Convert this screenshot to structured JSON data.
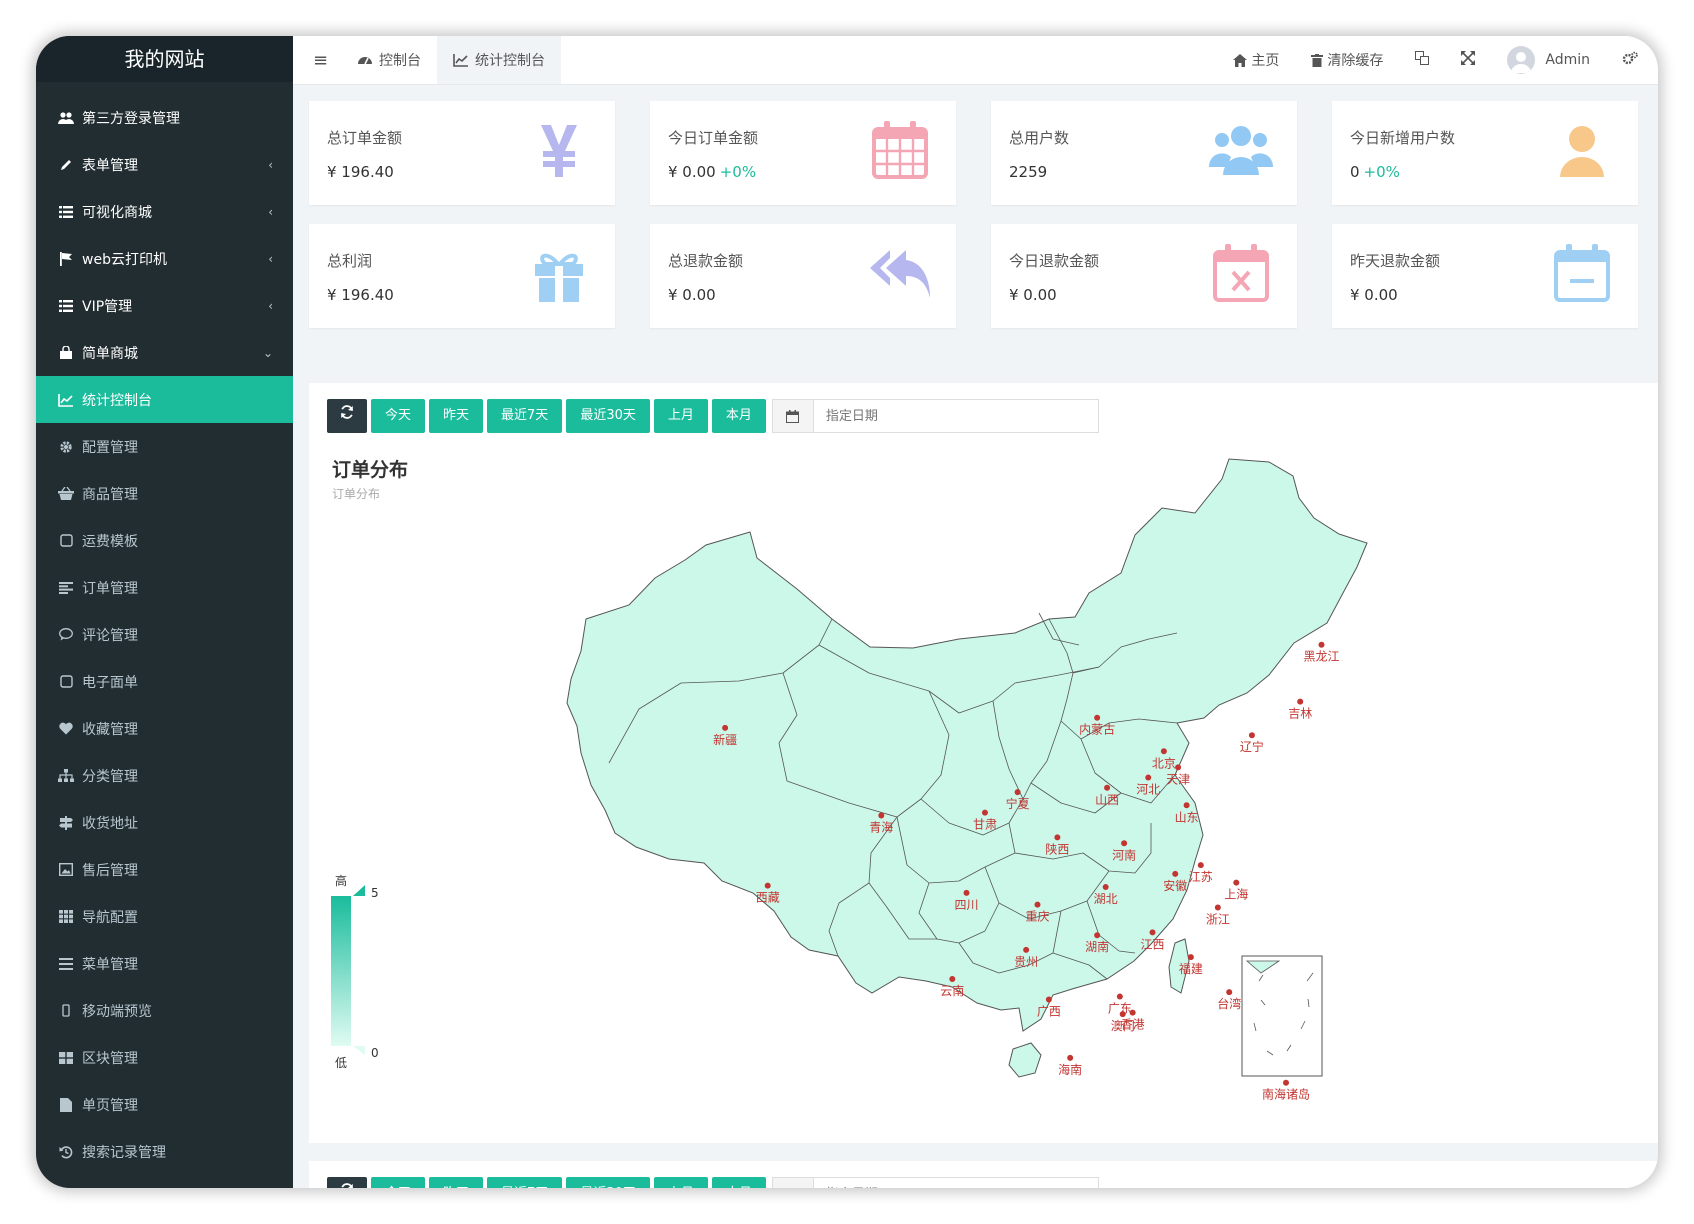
{
  "sidebar": {
    "logo": "我的网站",
    "items": [
      {
        "label": "第三方登录管理",
        "icon": "users-icon",
        "arrow": ""
      },
      {
        "label": "表单管理",
        "icon": "pencil-icon",
        "arrow": "‹"
      },
      {
        "label": "可视化商城",
        "icon": "list-icon",
        "arrow": "‹"
      },
      {
        "label": "web云打印机",
        "icon": "flag-icon",
        "arrow": "‹"
      },
      {
        "label": "VIP管理",
        "icon": "list-icon",
        "arrow": "‹"
      },
      {
        "label": "简单商城",
        "icon": "shopping-bag-icon",
        "arrow": "⌄"
      },
      {
        "label": "统计控制台",
        "icon": "line-chart-icon",
        "arrow": ""
      },
      {
        "label": "配置管理",
        "icon": "gear-icon",
        "arrow": ""
      },
      {
        "label": "商品管理",
        "icon": "basket-icon",
        "arrow": ""
      },
      {
        "label": "运费模板",
        "icon": "square-icon",
        "arrow": ""
      },
      {
        "label": "订单管理",
        "icon": "align-left-icon",
        "arrow": ""
      },
      {
        "label": "评论管理",
        "icon": "comment-icon",
        "arrow": ""
      },
      {
        "label": "电子面单",
        "icon": "square-icon",
        "arrow": ""
      },
      {
        "label": "收藏管理",
        "icon": "heart-icon",
        "arrow": ""
      },
      {
        "label": "分类管理",
        "icon": "sitemap-icon",
        "arrow": ""
      },
      {
        "label": "收货地址",
        "icon": "signpost-icon",
        "arrow": ""
      },
      {
        "label": "售后管理",
        "icon": "image-icon",
        "arrow": ""
      },
      {
        "label": "导航配置",
        "icon": "grid-icon",
        "arrow": ""
      },
      {
        "label": "菜单管理",
        "icon": "bars-icon",
        "arrow": ""
      },
      {
        "label": "移动端预览",
        "icon": "mobile-icon",
        "arrow": ""
      },
      {
        "label": "区块管理",
        "icon": "th-large-icon",
        "arrow": ""
      },
      {
        "label": "单页管理",
        "icon": "file-icon",
        "arrow": ""
      },
      {
        "label": "搜索记录管理",
        "icon": "history-icon",
        "arrow": ""
      }
    ],
    "active_index": 6
  },
  "topnav": {
    "tabs": [
      {
        "label": "控制台",
        "icon": "dashboard-icon"
      },
      {
        "label": "统计控制台",
        "icon": "line-chart-icon"
      }
    ],
    "home": "主页",
    "clear_cache": "清除缓存",
    "user": "Admin"
  },
  "cards": [
    {
      "label": "总订单金额",
      "value": "¥ 196.40",
      "pct": "",
      "icon": "yen-icon",
      "color": "#b7b7f0"
    },
    {
      "label": "今日订单金额",
      "value": "¥ 0.00",
      "pct": "+0%",
      "icon": "calendar-icon",
      "color": "#f5a6b4"
    },
    {
      "label": "总用户数",
      "value": "2259",
      "pct": "",
      "icon": "users-icon",
      "color": "#92c8f4"
    },
    {
      "label": "今日新增用户数",
      "value": "0",
      "pct": "+0%",
      "icon": "user-icon",
      "color": "#f7c88a"
    },
    {
      "label": "总利润",
      "value": "¥ 196.40",
      "pct": "",
      "icon": "gift-icon",
      "color": "#9fd0f4"
    },
    {
      "label": "总退款金额",
      "value": "¥ 0.00",
      "pct": "",
      "icon": "reply-all-icon",
      "color": "#b7b7f0"
    },
    {
      "label": "今日退款金额",
      "value": "¥ 0.00",
      "pct": "",
      "icon": "calendar-times-icon",
      "color": "#f5a6b4"
    },
    {
      "label": "昨天退款金额",
      "value": "¥ 0.00",
      "pct": "",
      "icon": "calendar-minus-icon",
      "color": "#9fd0f4"
    }
  ],
  "filters": {
    "buttons": [
      "今天",
      "昨天",
      "最近7天",
      "最近30天",
      "上月",
      "本月"
    ],
    "date_placeholder": "指定日期"
  },
  "map": {
    "title": "订单分布",
    "subtitle": "订单分布",
    "visual_map": {
      "high_label": "高",
      "low_label": "低",
      "max": "5",
      "min": "0"
    },
    "fill_color": "#ccf8ea",
    "border_color": "#555555",
    "point_color": "#c23531",
    "provinces": [
      {
        "name": "黑龙江",
        "lon": 127.5,
        "lat": 47.5
      },
      {
        "name": "吉林",
        "lon": 126.0,
        "lat": 43.6
      },
      {
        "name": "辽宁",
        "lon": 122.6,
        "lat": 41.3
      },
      {
        "name": "内蒙古",
        "lon": 111.7,
        "lat": 42.5
      },
      {
        "name": "北京",
        "lon": 116.4,
        "lat": 40.2
      },
      {
        "name": "天津",
        "lon": 117.4,
        "lat": 39.1
      },
      {
        "name": "河北",
        "lon": 115.3,
        "lat": 38.4
      },
      {
        "name": "山西",
        "lon": 112.4,
        "lat": 37.7
      },
      {
        "name": "山东",
        "lon": 118.0,
        "lat": 36.5
      },
      {
        "name": "宁夏",
        "lon": 106.1,
        "lat": 37.4
      },
      {
        "name": "青海",
        "lon": 96.5,
        "lat": 35.8
      },
      {
        "name": "甘肃",
        "lon": 103.8,
        "lat": 36.0
      },
      {
        "name": "陕西",
        "lon": 108.9,
        "lat": 34.3
      },
      {
        "name": "河南",
        "lon": 113.6,
        "lat": 33.9
      },
      {
        "name": "新疆",
        "lon": 85.5,
        "lat": 41.8
      },
      {
        "name": "西藏",
        "lon": 88.5,
        "lat": 31.0
      },
      {
        "name": "四川",
        "lon": 102.5,
        "lat": 30.5
      },
      {
        "name": "重庆",
        "lon": 107.5,
        "lat": 29.7
      },
      {
        "name": "湖北",
        "lon": 112.3,
        "lat": 30.9
      },
      {
        "name": "安徽",
        "lon": 117.2,
        "lat": 31.8
      },
      {
        "name": "江苏",
        "lon": 119.0,
        "lat": 32.4
      },
      {
        "name": "上海",
        "lon": 121.5,
        "lat": 31.2
      },
      {
        "name": "浙江",
        "lon": 120.2,
        "lat": 29.5
      },
      {
        "name": "湖南",
        "lon": 111.7,
        "lat": 27.6
      },
      {
        "name": "江西",
        "lon": 115.6,
        "lat": 27.8
      },
      {
        "name": "贵州",
        "lon": 106.7,
        "lat": 26.6
      },
      {
        "name": "云南",
        "lon": 101.5,
        "lat": 24.6
      },
      {
        "name": "福建",
        "lon": 118.3,
        "lat": 26.1
      },
      {
        "name": "台湾",
        "lon": 121.0,
        "lat": 23.7
      },
      {
        "name": "广东",
        "lon": 113.3,
        "lat": 23.4
      },
      {
        "name": "广西",
        "lon": 108.3,
        "lat": 23.2
      },
      {
        "name": "香港",
        "lon": 114.2,
        "lat": 22.3
      },
      {
        "name": "澳门",
        "lon": 113.5,
        "lat": 22.2
      },
      {
        "name": "海南",
        "lon": 109.8,
        "lat": 19.2
      },
      {
        "name": "南海诸岛",
        "lon": 125.0,
        "lat": 17.5
      }
    ]
  }
}
